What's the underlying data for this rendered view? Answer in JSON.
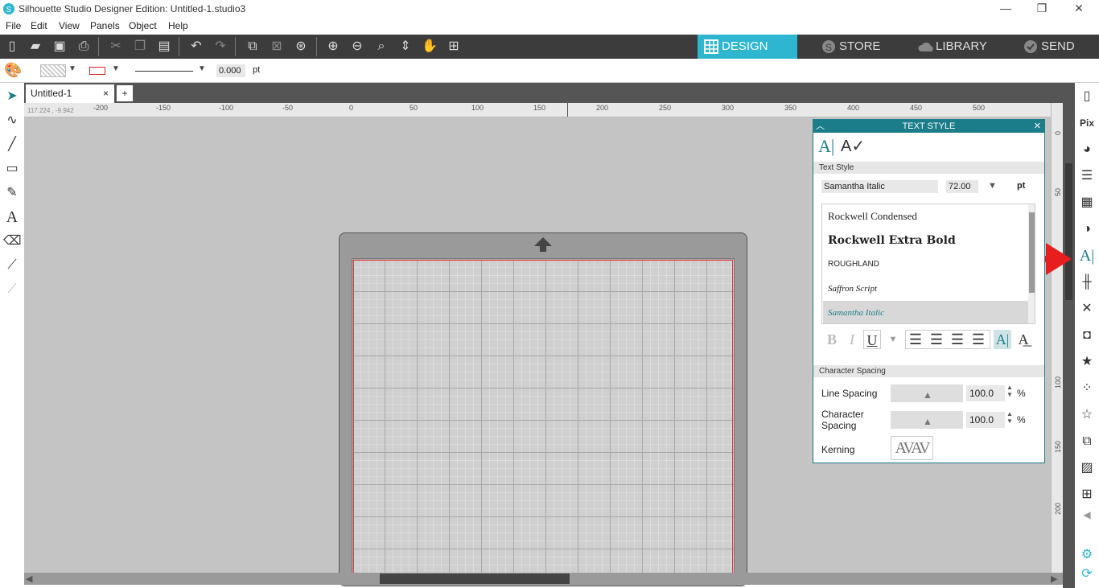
{
  "window": {
    "title": "Silhouette Studio Designer Edition: Untitled-1.studio3",
    "minimize": "—",
    "restore": "❐",
    "close": "✕"
  },
  "menu": [
    "File",
    "Edit",
    "View",
    "Panels",
    "Object",
    "Help"
  ],
  "mode_tabs": [
    {
      "label": "DESIGN",
      "active": true
    },
    {
      "label": "STORE",
      "active": false
    },
    {
      "label": "LIBRARY",
      "active": false
    },
    {
      "label": "SEND",
      "active": false
    }
  ],
  "props": {
    "line_width": "0.000",
    "line_unit": "pt"
  },
  "doc_tab": {
    "name": "Untitled-1",
    "close": "×",
    "add": "+"
  },
  "coordinates": "117.224 , -9.942",
  "ruler_h": [
    "-200",
    "-150",
    "-100",
    "-50",
    "0",
    "50",
    "100",
    "150",
    "200",
    "250",
    "300",
    "350",
    "400",
    "450",
    "500"
  ],
  "ruler_v": [
    "0",
    "50",
    "100",
    "150",
    "200"
  ],
  "text_panel": {
    "title": "TEXT STYLE",
    "section_text_style": "Text Style",
    "font_name": "Samantha Italic",
    "font_size": "72.00",
    "size_unit": "pt",
    "fonts": [
      {
        "name": "Rockwell Condensed",
        "selected": false
      },
      {
        "name": "Rockwell Extra Bold",
        "selected": false
      },
      {
        "name": "ROUGHLAND",
        "selected": false
      },
      {
        "name": "Saffron Script",
        "selected": false
      },
      {
        "name": "Samantha Italic",
        "selected": true
      }
    ],
    "format_buttons": [
      "B",
      "I",
      "U"
    ],
    "section_char_spacing": "Character Spacing",
    "line_spacing_label": "Line Spacing",
    "line_spacing_value": "100.0",
    "char_spacing_label": "Character Spacing",
    "char_spacing_value": "100.0",
    "percent": "%",
    "kerning_label": "Kerning",
    "kerning_sample": "AVAV"
  },
  "colors": {
    "accent": "#2eb6d0",
    "panel_header": "#1c7d8a",
    "toolbar": "#3c3c3c",
    "arrow": "#e81d1d",
    "cut_border": "#e43a3a"
  }
}
